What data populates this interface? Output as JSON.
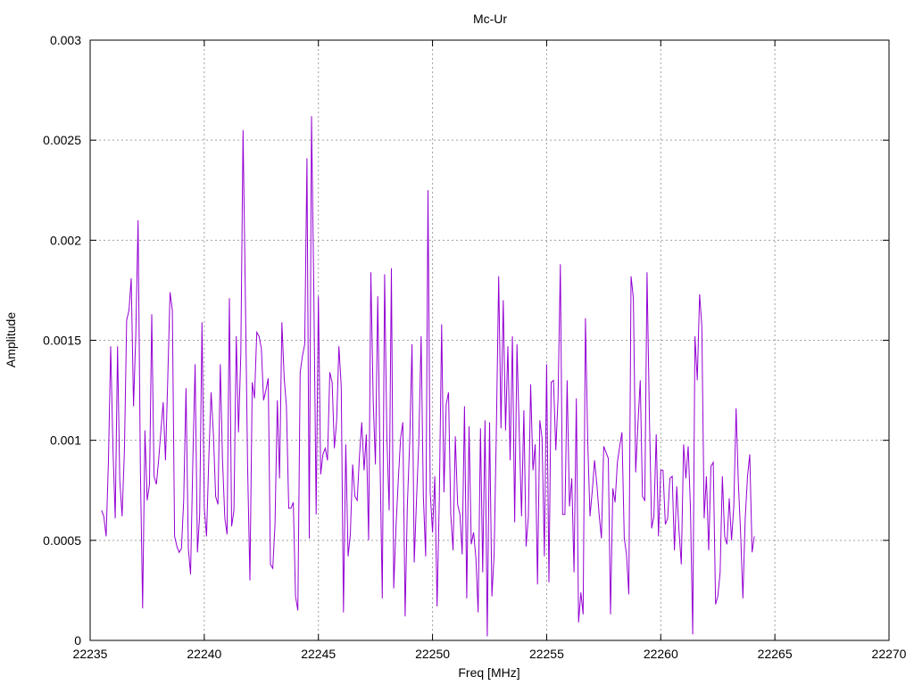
{
  "chart_data": {
    "type": "line",
    "title": "Mc-Ur",
    "xlabel": "Freq [MHz]",
    "ylabel": "Amplitude",
    "xlim": [
      22235,
      22270
    ],
    "ylim": [
      0,
      0.003
    ],
    "xticks": [
      "22235",
      "22240",
      "22245",
      "22250",
      "22255",
      "22260",
      "22265",
      "22270"
    ],
    "yticks": [
      "0",
      "0.0005",
      "0.001",
      "0.0015",
      "0.002",
      "0.0025",
      "0.003"
    ],
    "grid": true,
    "legend": "none",
    "series": [
      {
        "color": "#9400d3",
        "x_start": 22235.5,
        "x_step": 0.1,
        "values": [
          0.00065,
          0.00062,
          0.00052,
          0.0009,
          0.00147,
          0.00095,
          0.00061,
          0.00147,
          0.0008,
          0.00062,
          0.00095,
          0.0016,
          0.00165,
          0.00181,
          0.00117,
          0.00152,
          0.0021,
          0.00085,
          0.00016,
          0.00105,
          0.0007,
          0.00078,
          0.00163,
          0.00082,
          0.00078,
          0.0009,
          0.00105,
          0.00119,
          0.0009,
          0.0013,
          0.00174,
          0.00165,
          0.00052,
          0.00047,
          0.00044,
          0.00046,
          0.0007,
          0.00126,
          0.00046,
          0.00033,
          0.00091,
          0.00138,
          0.00044,
          0.00063,
          0.00159,
          0.00066,
          0.00052,
          0.00092,
          0.00124,
          0.00103,
          0.00072,
          0.00068,
          0.00138,
          0.0009,
          0.00061,
          0.00053,
          0.00171,
          0.00057,
          0.00065,
          0.00152,
          0.00104,
          0.00143,
          0.00255,
          0.00172,
          0.00087,
          0.0003,
          0.00129,
          0.00121,
          0.00154,
          0.00152,
          0.00146,
          0.0012,
          0.00125,
          0.00131,
          0.00038,
          0.00036,
          0.00058,
          0.0012,
          0.00081,
          0.00159,
          0.00131,
          0.00117,
          0.00066,
          0.00066,
          0.00069,
          0.00022,
          0.00015,
          0.00134,
          0.00142,
          0.00148,
          0.00241,
          0.00051,
          0.00262,
          0.00174,
          0.00063,
          0.00172,
          0.00083,
          0.00093,
          0.00096,
          0.0009,
          0.00134,
          0.00129,
          0.00096,
          0.0011,
          0.00147,
          0.00127,
          0.00014,
          0.00098,
          0.00042,
          0.00053,
          0.00088,
          0.00072,
          0.0007,
          0.00092,
          0.00109,
          0.00085,
          0.00103,
          0.0005,
          0.00184,
          0.0012,
          0.00088,
          0.00172,
          0.00089,
          0.00021,
          0.00183,
          0.00102,
          0.00065,
          0.00186,
          0.00026,
          0.00057,
          0.0008,
          0.00101,
          0.00109,
          0.00012,
          0.00068,
          0.00099,
          0.00148,
          0.00039,
          0.00071,
          0.00099,
          0.00152,
          0.00072,
          0.00042,
          0.00225,
          0.00074,
          0.00054,
          0.00082,
          0.00017,
          0.00071,
          0.00158,
          0.00074,
          0.00118,
          0.00124,
          0.00063,
          0.00045,
          0.00102,
          0.00068,
          0.00063,
          0.00043,
          0.00117,
          0.00021,
          0.00107,
          0.00048,
          0.00054,
          0.00041,
          0.00014,
          0.00106,
          0.00034,
          0.0011,
          2e-05,
          0.00109,
          0.00022,
          0.00043,
          0.00108,
          0.00182,
          0.00106,
          0.0017,
          0.00105,
          0.00147,
          0.0009,
          0.00152,
          0.00059,
          0.00148,
          0.00105,
          0.00062,
          0.00115,
          0.00047,
          0.00062,
          0.00128,
          0.00085,
          0.00098,
          0.00028,
          0.0011,
          0.00101,
          0.00042,
          0.00138,
          0.00029,
          0.00129,
          0.0013,
          0.00095,
          0.00121,
          0.00188,
          0.00063,
          0.00063,
          0.0013,
          0.00067,
          0.00081,
          0.00034,
          0.00121,
          9e-05,
          0.00024,
          0.00013,
          0.00161,
          0.00099,
          0.00062,
          0.00075,
          0.0009,
          0.00078,
          0.00063,
          0.00051,
          0.00097,
          0.00094,
          0.00091,
          0.00013,
          0.00076,
          0.00069,
          0.00089,
          0.00097,
          0.00104,
          0.00051,
          0.00043,
          0.00023,
          0.00182,
          0.00171,
          0.00084,
          0.00108,
          0.0013,
          0.00072,
          0.0007,
          0.00184,
          0.00113,
          0.00056,
          0.00062,
          0.00103,
          0.00052,
          0.00085,
          0.00085,
          0.00058,
          0.00061,
          0.00081,
          0.00082,
          0.00045,
          0.00077,
          0.00055,
          0.00038,
          0.00098,
          0.00081,
          0.00097,
          0.00067,
          3e-05,
          0.00152,
          0.0013,
          0.00173,
          0.00157,
          0.00061,
          0.00082,
          0.00045,
          0.00087,
          0.00089,
          0.00018,
          0.00022,
          0.00034,
          0.00082,
          0.00052,
          0.00048,
          0.00071,
          0.0005,
          0.00067,
          0.00116,
          0.00079,
          0.00053,
          0.00021,
          0.00061,
          0.00082,
          0.00093,
          0.00044,
          0.00052
        ]
      }
    ]
  }
}
